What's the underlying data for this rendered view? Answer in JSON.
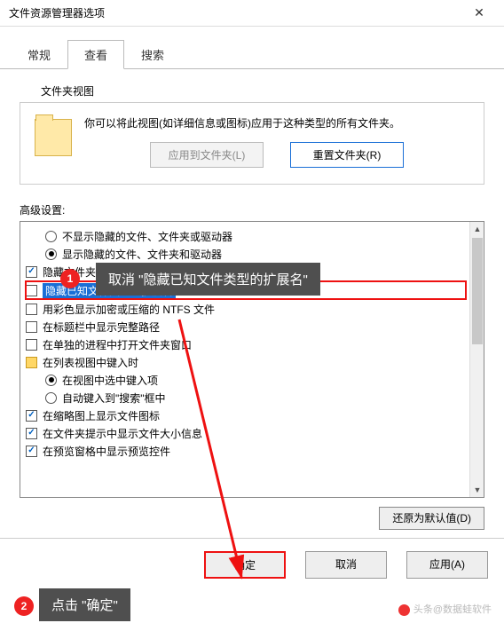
{
  "window": {
    "title": "文件资源管理器选项"
  },
  "tabs": {
    "general": "常规",
    "view": "查看",
    "search": "搜索"
  },
  "folderview": {
    "label": "文件夹视图",
    "desc": "你可以将此视图(如详细信息或图标)应用于这种类型的所有文件夹。",
    "apply": "应用到文件夹(L)",
    "reset": "重置文件夹(R)"
  },
  "advanced": {
    "label": "高级设置:",
    "items": [
      {
        "kind": "radio",
        "indent": 1,
        "checked": false,
        "text": "不显示隐藏的文件、文件夹或驱动器"
      },
      {
        "kind": "radio",
        "indent": 1,
        "checked": true,
        "text": "显示隐藏的文件、文件夹和驱动器"
      },
      {
        "kind": "check",
        "indent": 0,
        "checked": true,
        "text": "隐藏文件夹合并冲突"
      },
      {
        "kind": "check",
        "indent": 0,
        "checked": false,
        "hl": true,
        "text": "隐藏已知文件类型的扩展名"
      },
      {
        "kind": "check",
        "indent": 0,
        "checked": false,
        "text": "用彩色显示加密或压缩的 NTFS 文件"
      },
      {
        "kind": "check",
        "indent": 0,
        "checked": false,
        "text": "在标题栏中显示完整路径"
      },
      {
        "kind": "check",
        "indent": 0,
        "checked": false,
        "text": "在单独的进程中打开文件夹窗口"
      },
      {
        "kind": "folder",
        "indent": 0,
        "text": "在列表视图中键入时"
      },
      {
        "kind": "radio",
        "indent": 1,
        "checked": true,
        "text": "在视图中选中键入项"
      },
      {
        "kind": "radio",
        "indent": 1,
        "checked": false,
        "text": "自动键入到\"搜索\"框中"
      },
      {
        "kind": "check",
        "indent": 0,
        "checked": true,
        "text": "在缩略图上显示文件图标"
      },
      {
        "kind": "check",
        "indent": 0,
        "checked": true,
        "text": "在文件夹提示中显示文件大小信息"
      },
      {
        "kind": "check",
        "indent": 0,
        "checked": true,
        "text": "在预览窗格中显示预览控件"
      }
    ],
    "restore": "还原为默认值(D)"
  },
  "buttons": {
    "ok": "确定",
    "cancel": "取消",
    "apply": "应用(A)"
  },
  "annotations": {
    "step1": "1",
    "callout1": "取消 \"隐藏已知文件类型的扩展名\"",
    "step2": "2",
    "callout2": "点击 \"确定\"",
    "watermark": "头条@数据蛙软件"
  }
}
